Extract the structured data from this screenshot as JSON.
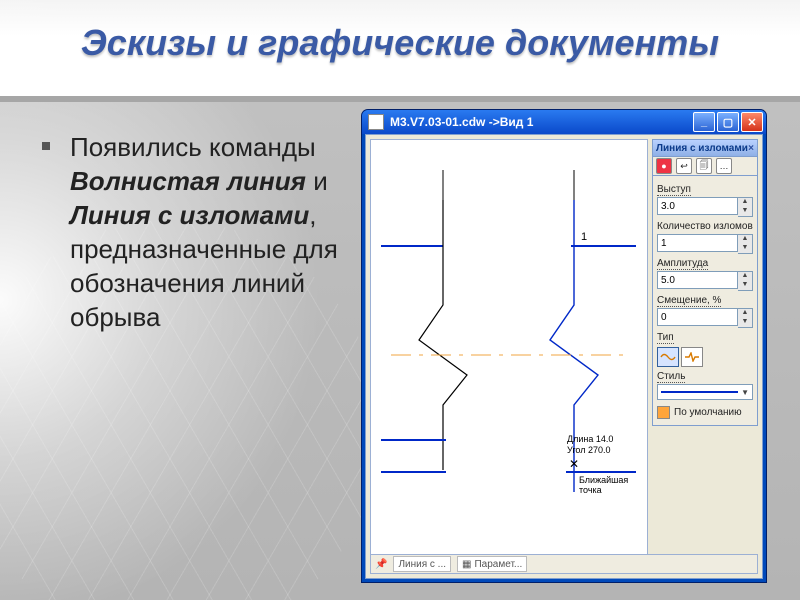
{
  "title": "Эскизы и графические документы",
  "bullet": {
    "pre": "Появились команды ",
    "cmd1": "Волнистая линия",
    "mid": " и ",
    "cmd2": "Линия с изломами",
    "post": ", предназначенные для обозначения линий обрыва"
  },
  "app": {
    "title": "M3.V7.03-01.cdw ->Вид 1",
    "win_min": "_",
    "win_max": "▢",
    "win_close": "✕",
    "palette_title": "Линия с изломами",
    "palette_x": "×",
    "fields": {
      "vystup_label": "Выступ",
      "vystup_value": "3.0",
      "kol_label": "Количество изломов",
      "kol_value": "1",
      "amp_label": "Амплитуда",
      "amp_value": "5.0",
      "off_label": "Смещение, %",
      "off_value": "0",
      "type_label": "Тип",
      "style_label": "Стиль",
      "default_label": "По умолчанию"
    },
    "canvas": {
      "marker1": "1",
      "dlina": "Длина 14.0",
      "ugol": "Угол 270.0",
      "near": "Ближайшая точка"
    },
    "status": {
      "tab1": "Линия с ...",
      "tab2": "Парамет..."
    }
  }
}
